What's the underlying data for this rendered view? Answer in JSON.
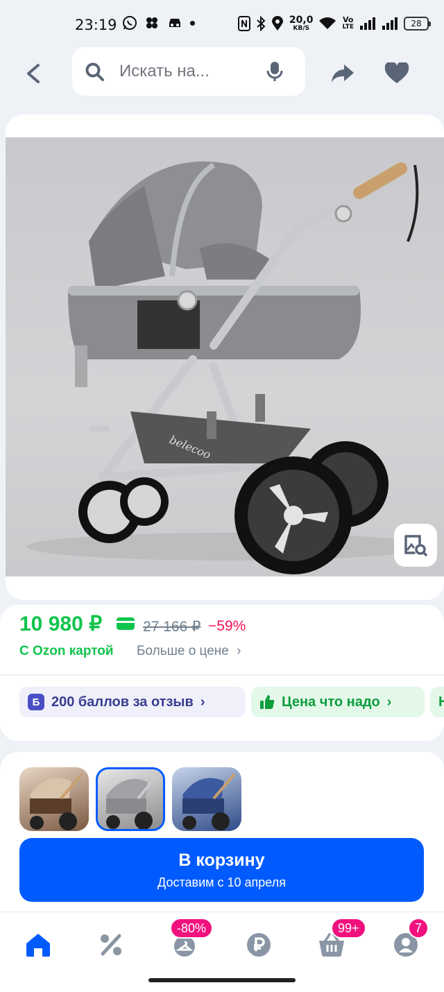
{
  "status_bar": {
    "time": "23:19",
    "net_speed_value": "20,0",
    "net_speed_unit": "KB/S",
    "volte_top": "Vo",
    "volte_bottom": "LTE",
    "battery": "28",
    "icons": [
      "whatsapp-icon",
      "app-icon",
      "car-icon",
      "dot-icon",
      "nfc-icon",
      "bluetooth-icon",
      "location-icon",
      "wifi-icon",
      "signal-icon",
      "signal-icon",
      "battery-icon"
    ]
  },
  "header": {
    "search_placeholder": "Искать на...",
    "icons": [
      "back-arrow-icon",
      "search-icon",
      "microphone-icon",
      "share-icon",
      "heart-icon"
    ]
  },
  "product": {
    "brand_text": "belecoo",
    "visual_search_icon": "image-search-icon"
  },
  "price": {
    "current": "10 980 ₽",
    "old": "27 166 ₽",
    "discount": "−59%",
    "ozon_card_label": "С Ozon картой",
    "more_label": "Больше о цене",
    "accent_green": "#10c44c",
    "accent_pink": "#f91155"
  },
  "chips": [
    {
      "badge": "Б",
      "label": "200 баллов за отзыв",
      "chevron": "›"
    },
    {
      "label": "Цена что надо",
      "chevron": "›"
    },
    {
      "label": "Н"
    }
  ],
  "cart": {
    "title": "В корзину",
    "subtitle": "Доставим с 10 апреля",
    "color": "#005bff"
  },
  "bottom_nav": {
    "items": [
      {
        "name": "home",
        "icon": "home-icon"
      },
      {
        "name": "discounts",
        "icon": "percent-icon"
      },
      {
        "name": "fresh",
        "icon": "hanger-icon",
        "badge": "-80%"
      },
      {
        "name": "finance",
        "icon": "ruble-icon"
      },
      {
        "name": "cart",
        "icon": "basket-icon",
        "badge": "99+"
      },
      {
        "name": "profile",
        "icon": "profile-icon",
        "badge": "7"
      }
    ]
  }
}
